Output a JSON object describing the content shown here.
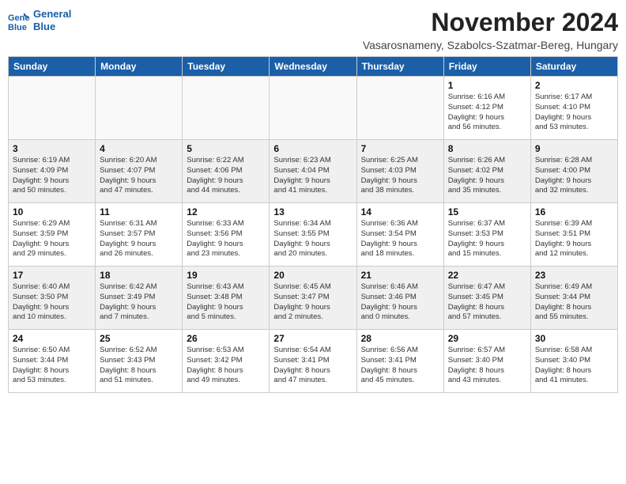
{
  "header": {
    "logo_line1": "General",
    "logo_line2": "Blue",
    "month_title": "November 2024",
    "subtitle": "Vasarosnameny, Szabolcs-Szatmar-Bereg, Hungary"
  },
  "weekdays": [
    "Sunday",
    "Monday",
    "Tuesday",
    "Wednesday",
    "Thursday",
    "Friday",
    "Saturday"
  ],
  "weeks": [
    [
      {
        "day": "",
        "info": ""
      },
      {
        "day": "",
        "info": ""
      },
      {
        "day": "",
        "info": ""
      },
      {
        "day": "",
        "info": ""
      },
      {
        "day": "",
        "info": ""
      },
      {
        "day": "1",
        "info": "Sunrise: 6:16 AM\nSunset: 4:12 PM\nDaylight: 9 hours\nand 56 minutes."
      },
      {
        "day": "2",
        "info": "Sunrise: 6:17 AM\nSunset: 4:10 PM\nDaylight: 9 hours\nand 53 minutes."
      }
    ],
    [
      {
        "day": "3",
        "info": "Sunrise: 6:19 AM\nSunset: 4:09 PM\nDaylight: 9 hours\nand 50 minutes."
      },
      {
        "day": "4",
        "info": "Sunrise: 6:20 AM\nSunset: 4:07 PM\nDaylight: 9 hours\nand 47 minutes."
      },
      {
        "day": "5",
        "info": "Sunrise: 6:22 AM\nSunset: 4:06 PM\nDaylight: 9 hours\nand 44 minutes."
      },
      {
        "day": "6",
        "info": "Sunrise: 6:23 AM\nSunset: 4:04 PM\nDaylight: 9 hours\nand 41 minutes."
      },
      {
        "day": "7",
        "info": "Sunrise: 6:25 AM\nSunset: 4:03 PM\nDaylight: 9 hours\nand 38 minutes."
      },
      {
        "day": "8",
        "info": "Sunrise: 6:26 AM\nSunset: 4:02 PM\nDaylight: 9 hours\nand 35 minutes."
      },
      {
        "day": "9",
        "info": "Sunrise: 6:28 AM\nSunset: 4:00 PM\nDaylight: 9 hours\nand 32 minutes."
      }
    ],
    [
      {
        "day": "10",
        "info": "Sunrise: 6:29 AM\nSunset: 3:59 PM\nDaylight: 9 hours\nand 29 minutes."
      },
      {
        "day": "11",
        "info": "Sunrise: 6:31 AM\nSunset: 3:57 PM\nDaylight: 9 hours\nand 26 minutes."
      },
      {
        "day": "12",
        "info": "Sunrise: 6:33 AM\nSunset: 3:56 PM\nDaylight: 9 hours\nand 23 minutes."
      },
      {
        "day": "13",
        "info": "Sunrise: 6:34 AM\nSunset: 3:55 PM\nDaylight: 9 hours\nand 20 minutes."
      },
      {
        "day": "14",
        "info": "Sunrise: 6:36 AM\nSunset: 3:54 PM\nDaylight: 9 hours\nand 18 minutes."
      },
      {
        "day": "15",
        "info": "Sunrise: 6:37 AM\nSunset: 3:53 PM\nDaylight: 9 hours\nand 15 minutes."
      },
      {
        "day": "16",
        "info": "Sunrise: 6:39 AM\nSunset: 3:51 PM\nDaylight: 9 hours\nand 12 minutes."
      }
    ],
    [
      {
        "day": "17",
        "info": "Sunrise: 6:40 AM\nSunset: 3:50 PM\nDaylight: 9 hours\nand 10 minutes."
      },
      {
        "day": "18",
        "info": "Sunrise: 6:42 AM\nSunset: 3:49 PM\nDaylight: 9 hours\nand 7 minutes."
      },
      {
        "day": "19",
        "info": "Sunrise: 6:43 AM\nSunset: 3:48 PM\nDaylight: 9 hours\nand 5 minutes."
      },
      {
        "day": "20",
        "info": "Sunrise: 6:45 AM\nSunset: 3:47 PM\nDaylight: 9 hours\nand 2 minutes."
      },
      {
        "day": "21",
        "info": "Sunrise: 6:46 AM\nSunset: 3:46 PM\nDaylight: 9 hours\nand 0 minutes."
      },
      {
        "day": "22",
        "info": "Sunrise: 6:47 AM\nSunset: 3:45 PM\nDaylight: 8 hours\nand 57 minutes."
      },
      {
        "day": "23",
        "info": "Sunrise: 6:49 AM\nSunset: 3:44 PM\nDaylight: 8 hours\nand 55 minutes."
      }
    ],
    [
      {
        "day": "24",
        "info": "Sunrise: 6:50 AM\nSunset: 3:44 PM\nDaylight: 8 hours\nand 53 minutes."
      },
      {
        "day": "25",
        "info": "Sunrise: 6:52 AM\nSunset: 3:43 PM\nDaylight: 8 hours\nand 51 minutes."
      },
      {
        "day": "26",
        "info": "Sunrise: 6:53 AM\nSunset: 3:42 PM\nDaylight: 8 hours\nand 49 minutes."
      },
      {
        "day": "27",
        "info": "Sunrise: 6:54 AM\nSunset: 3:41 PM\nDaylight: 8 hours\nand 47 minutes."
      },
      {
        "day": "28",
        "info": "Sunrise: 6:56 AM\nSunset: 3:41 PM\nDaylight: 8 hours\nand 45 minutes."
      },
      {
        "day": "29",
        "info": "Sunrise: 6:57 AM\nSunset: 3:40 PM\nDaylight: 8 hours\nand 43 minutes."
      },
      {
        "day": "30",
        "info": "Sunrise: 6:58 AM\nSunset: 3:40 PM\nDaylight: 8 hours\nand 41 minutes."
      }
    ]
  ]
}
